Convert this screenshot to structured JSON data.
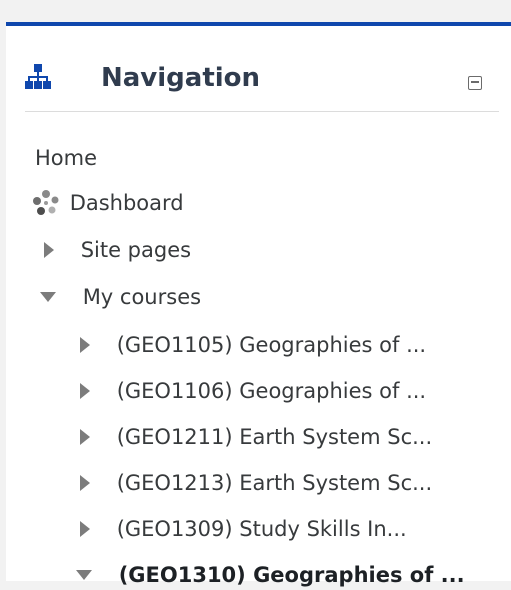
{
  "navigation": {
    "title": "Navigation",
    "items": [
      {
        "label": "Home"
      },
      {
        "label": "Dashboard"
      },
      {
        "label": "Site pages"
      },
      {
        "label": "My courses"
      }
    ],
    "courses": [
      {
        "label": "(GEO1105) Geographies of ..."
      },
      {
        "label": "(GEO1106) Geographies of ..."
      },
      {
        "label": "(GEO1211) Earth System Sc..."
      },
      {
        "label": "(GEO1213) Earth System Sc..."
      },
      {
        "label": "(GEO1309) Study Skills In..."
      },
      {
        "label": "(GEO1310) Geographies of ..."
      }
    ],
    "icons": {
      "header": "sitemap-icon",
      "dashboard": "dashboard-icon",
      "collapse": "minus-square-icon",
      "collapsed": "caret-right-icon",
      "expanded": "caret-down-icon"
    },
    "colors": {
      "accent_bar": "#0f47ad",
      "title": "#303c4e",
      "icon": "#0f47ad",
      "text": "#373a3c",
      "caret": "#7c7c7c"
    }
  }
}
